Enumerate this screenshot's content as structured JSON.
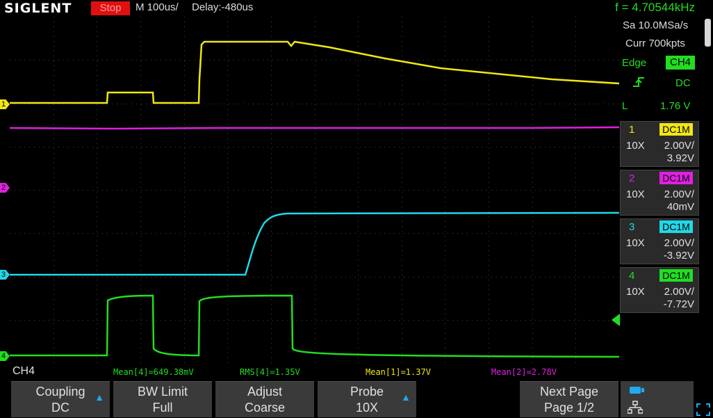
{
  "header": {
    "brand": "SIGLENT",
    "run_state": "Stop",
    "timebase": "M 100us/",
    "delay": "Delay:-480us",
    "frequency": "f = 4.70544kHz"
  },
  "right_panel": {
    "sample_rate": "Sa 10.0MSa/s",
    "memory": "Curr 700kpts",
    "trigger": {
      "type": "Edge",
      "source": "CH4",
      "slope_icon": "rising-edge-icon",
      "coupling": "DC",
      "level_label": "L",
      "level": "1.76 V"
    },
    "channels": [
      {
        "num": "1",
        "coupling": "DC1M",
        "probe": "10X",
        "scale": "2.00V/",
        "offset": "3.92V",
        "color": "#f0e614"
      },
      {
        "num": "2",
        "coupling": "DC1M",
        "probe": "10X",
        "scale": "2.00V/",
        "offset": "40mV",
        "color": "#e020e0"
      },
      {
        "num": "3",
        "coupling": "DC1M",
        "probe": "10X",
        "scale": "2.00V/",
        "offset": "-3.92V",
        "color": "#20d8e8"
      },
      {
        "num": "4",
        "coupling": "DC1M",
        "probe": "10X",
        "scale": "2.00V/",
        "offset": "-7.72V",
        "color": "#22dd22"
      }
    ]
  },
  "status_bar": {
    "menu_channel": "CH4",
    "measurements": [
      {
        "text": "Mean[4]=649.38mV",
        "color": "#22dd22"
      },
      {
        "text": "RMS[4]=1.35V",
        "color": "#22dd22"
      },
      {
        "text": "Mean[1]=1.37V",
        "color": "#f0e614"
      },
      {
        "text": "Mean[2]=2.78V",
        "color": "#e020e0"
      }
    ]
  },
  "softkeys": [
    {
      "line1": "Coupling",
      "line2": "DC"
    },
    {
      "line1": "BW Limit",
      "line2": "Full"
    },
    {
      "line1": "Adjust",
      "line2": "Coarse"
    },
    {
      "line1": "Probe",
      "line2": "10X"
    },
    {
      "line1": "Next Page",
      "line2": "Page 1/2"
    }
  ],
  "icons": {
    "usb": "usb-icon",
    "network": "network-icon",
    "fullscreen": "fullscreen-icon",
    "trigger_position": "trigger-position-marker-icon",
    "arrow": "arrow-up-icon"
  },
  "markers": [
    "1",
    "2",
    "3",
    "4"
  ]
}
